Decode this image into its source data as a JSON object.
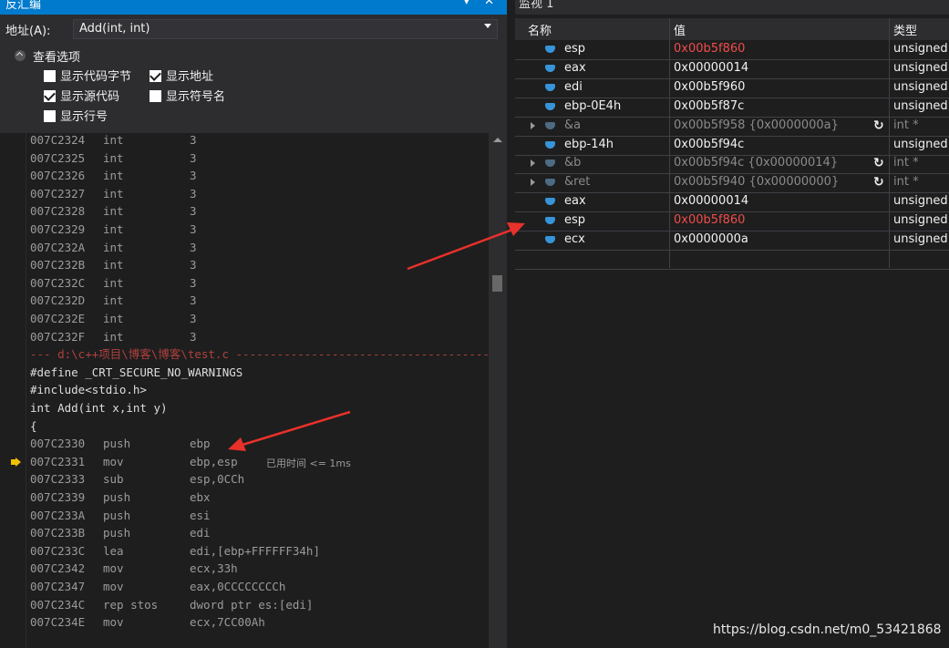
{
  "disasm": {
    "title": "反汇编",
    "address_label": "地址(A):",
    "address_value": "Add(int, int)",
    "options_title": "查看选项",
    "opt_code_bytes": "显示代码字节",
    "opt_address": "显示地址",
    "opt_source": "显示源代码",
    "opt_symbols": "显示符号名",
    "opt_line_numbers": "显示行号",
    "lines": [
      {
        "addr": "007C2324",
        "op": "int",
        "arg": "3"
      },
      {
        "addr": "007C2325",
        "op": "int",
        "arg": "3"
      },
      {
        "addr": "007C2326",
        "op": "int",
        "arg": "3"
      },
      {
        "addr": "007C2327",
        "op": "int",
        "arg": "3"
      },
      {
        "addr": "007C2328",
        "op": "int",
        "arg": "3"
      },
      {
        "addr": "007C2329",
        "op": "int",
        "arg": "3"
      },
      {
        "addr": "007C232A",
        "op": "int",
        "arg": "3"
      },
      {
        "addr": "007C232B",
        "op": "int",
        "arg": "3"
      },
      {
        "addr": "007C232C",
        "op": "int",
        "arg": "3"
      },
      {
        "addr": "007C232D",
        "op": "int",
        "arg": "3"
      },
      {
        "addr": "007C232E",
        "op": "int",
        "arg": "3"
      },
      {
        "addr": "007C232F",
        "op": "int",
        "arg": "3"
      }
    ],
    "file_header": "--- d:\\c++项目\\博客\\博客\\test.c -----------------------------------------",
    "source_lines": [
      "#define _CRT_SECURE_NO_WARNINGS",
      "#include<stdio.h>",
      "int Add(int x,int y)",
      "{"
    ],
    "asm_lines": [
      {
        "addr": "007C2330",
        "op": "push",
        "arg": "ebp"
      },
      {
        "addr": "007C2331",
        "op": "mov",
        "arg": "ebp,esp"
      },
      {
        "addr": "007C2333",
        "op": "sub",
        "arg": "esp,0CCh"
      },
      {
        "addr": "007C2339",
        "op": "push",
        "arg": "ebx"
      },
      {
        "addr": "007C233A",
        "op": "push",
        "arg": "esi"
      },
      {
        "addr": "007C233B",
        "op": "push",
        "arg": "edi"
      },
      {
        "addr": "007C233C",
        "op": "lea",
        "arg": "edi,[ebp+FFFFFF34h]"
      },
      {
        "addr": "007C2342",
        "op": "mov",
        "arg": "ecx,33h"
      },
      {
        "addr": "007C2347",
        "op": "mov",
        "arg": "eax,0CCCCCCCCh"
      },
      {
        "addr": "007C234C",
        "op": "rep stos",
        "arg": "dword ptr es:[edi]"
      },
      {
        "addr": "007C234E",
        "op": "mov",
        "arg": "ecx,7CC00Ah"
      }
    ],
    "elapsed": "已用时间 <= 1ms"
  },
  "watch": {
    "title": "监视 1",
    "col_name": "名称",
    "col_value": "值",
    "col_type": "类型",
    "rows": [
      {
        "name": "esp",
        "value": "0x00b5f860",
        "type": "unsigned",
        "red": true,
        "dim": false,
        "expand": false,
        "refresh": false
      },
      {
        "name": "eax",
        "value": "0x00000014",
        "type": "unsigned",
        "red": false,
        "dim": false,
        "expand": false,
        "refresh": false
      },
      {
        "name": "edi",
        "value": "0x00b5f960",
        "type": "unsigned",
        "red": false,
        "dim": false,
        "expand": false,
        "refresh": false
      },
      {
        "name": "ebp-0E4h",
        "value": "0x00b5f87c",
        "type": "unsigned",
        "red": false,
        "dim": false,
        "expand": false,
        "refresh": false
      },
      {
        "name": "&a",
        "value": "0x00b5f958 {0x0000000a}",
        "type": "int *",
        "red": false,
        "dim": true,
        "expand": true,
        "refresh": true
      },
      {
        "name": "ebp-14h",
        "value": "0x00b5f94c",
        "type": "unsigned",
        "red": false,
        "dim": false,
        "expand": false,
        "refresh": false
      },
      {
        "name": "&b",
        "value": "0x00b5f94c {0x00000014}",
        "type": "int *",
        "red": false,
        "dim": true,
        "expand": true,
        "refresh": true
      },
      {
        "name": "&ret",
        "value": "0x00b5f940 {0x00000000}",
        "type": "int *",
        "red": false,
        "dim": true,
        "expand": true,
        "refresh": true
      },
      {
        "name": "eax",
        "value": "0x00000014",
        "type": "unsigned",
        "red": false,
        "dim": false,
        "expand": false,
        "refresh": false
      },
      {
        "name": "esp",
        "value": "0x00b5f860",
        "type": "unsigned",
        "red": true,
        "dim": false,
        "expand": false,
        "refresh": false
      },
      {
        "name": "ecx",
        "value": "0x0000000a",
        "type": "unsigned",
        "red": false,
        "dim": false,
        "expand": false,
        "refresh": false
      }
    ]
  },
  "watermark": "https://blog.csdn.net/m0_53421868",
  "colors": {
    "accent": "#007acc",
    "value_changed": "#f14c4c",
    "annotation_arrow": "#e8312a"
  }
}
